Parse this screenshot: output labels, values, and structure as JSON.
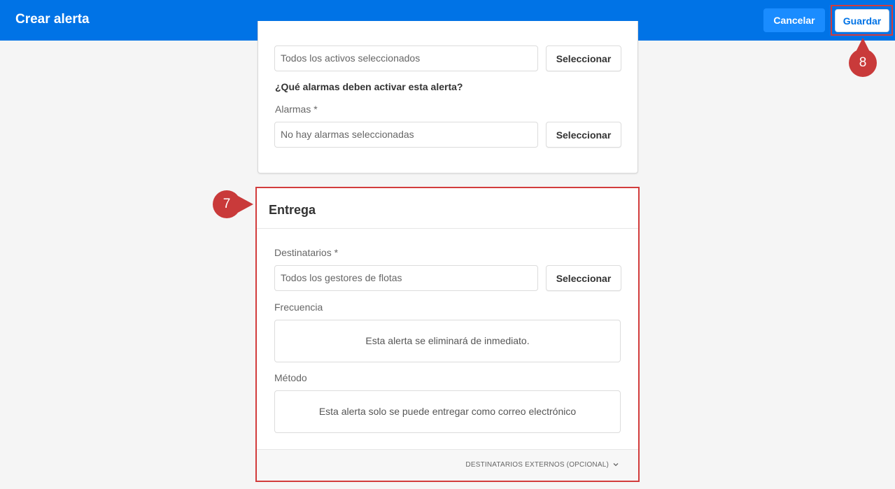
{
  "header": {
    "title": "Crear alerta",
    "cancel_label": "Cancelar",
    "save_label": "Guardar"
  },
  "assets": {
    "value": "Todos los activos seleccionados",
    "select_label": "Seleccionar"
  },
  "alarms": {
    "question": "¿Qué alarmas deben activar esta alerta?",
    "label": "Alarmas *",
    "value": "No hay alarmas seleccionadas",
    "select_label": "Seleccionar"
  },
  "delivery": {
    "title": "Entrega",
    "recipients_label": "Destinatarios *",
    "recipients_value": "Todos los gestores de flotas",
    "select_label": "Seleccionar",
    "frequency_label": "Frecuencia",
    "frequency_text": "Esta alerta se eliminará de inmediato.",
    "method_label": "Método",
    "method_text": "Esta alerta solo se puede entregar como correo electrónico",
    "external_label": "DESTINATARIOS EXTERNOS (OPCIONAL)"
  },
  "callouts": {
    "step7": "7",
    "step8": "8"
  },
  "colors": {
    "brand": "#0073e6",
    "callout": "#c93a3a"
  }
}
